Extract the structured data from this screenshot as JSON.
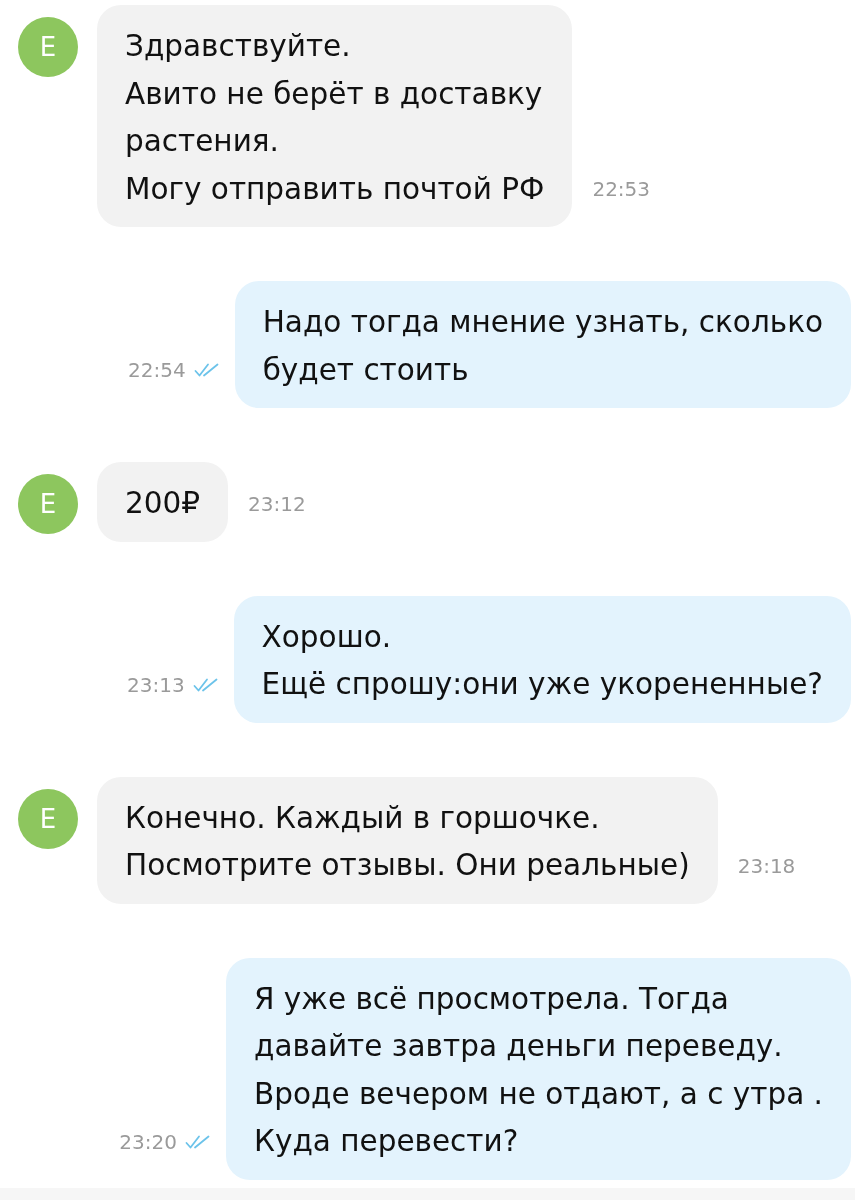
{
  "messages": [
    {
      "kind": "incoming",
      "avatar": "Е",
      "text": "Здравствуйте.\nАвито не берёт в доставку\nрастения.\nМогу отправить почтой РФ",
      "time": "22:53"
    },
    {
      "kind": "outgoing",
      "text": "Надо тогда мнение узнать, сколько\nбудет стоить",
      "time": "22:54",
      "read": true
    },
    {
      "kind": "incoming",
      "avatar": "Е",
      "text": "200₽",
      "time": "23:12"
    },
    {
      "kind": "outgoing",
      "text": "Хорошо.\nЕщё спрошу:они уже укорененные?",
      "time": "23:13",
      "read": true
    },
    {
      "kind": "incoming",
      "avatar": "Е",
      "text": "Конечно. Каждый в горшочке.\nПосмотрите отзывы. Они реальные)",
      "time": "23:18"
    },
    {
      "kind": "outgoing",
      "text": "Я уже всё просмотрела. Тогда\nдавайте завтра деньги переведу.\nВроде вечером не отдают, а с утра .\nКуда перевести?",
      "time": "23:20",
      "read": true
    }
  ]
}
